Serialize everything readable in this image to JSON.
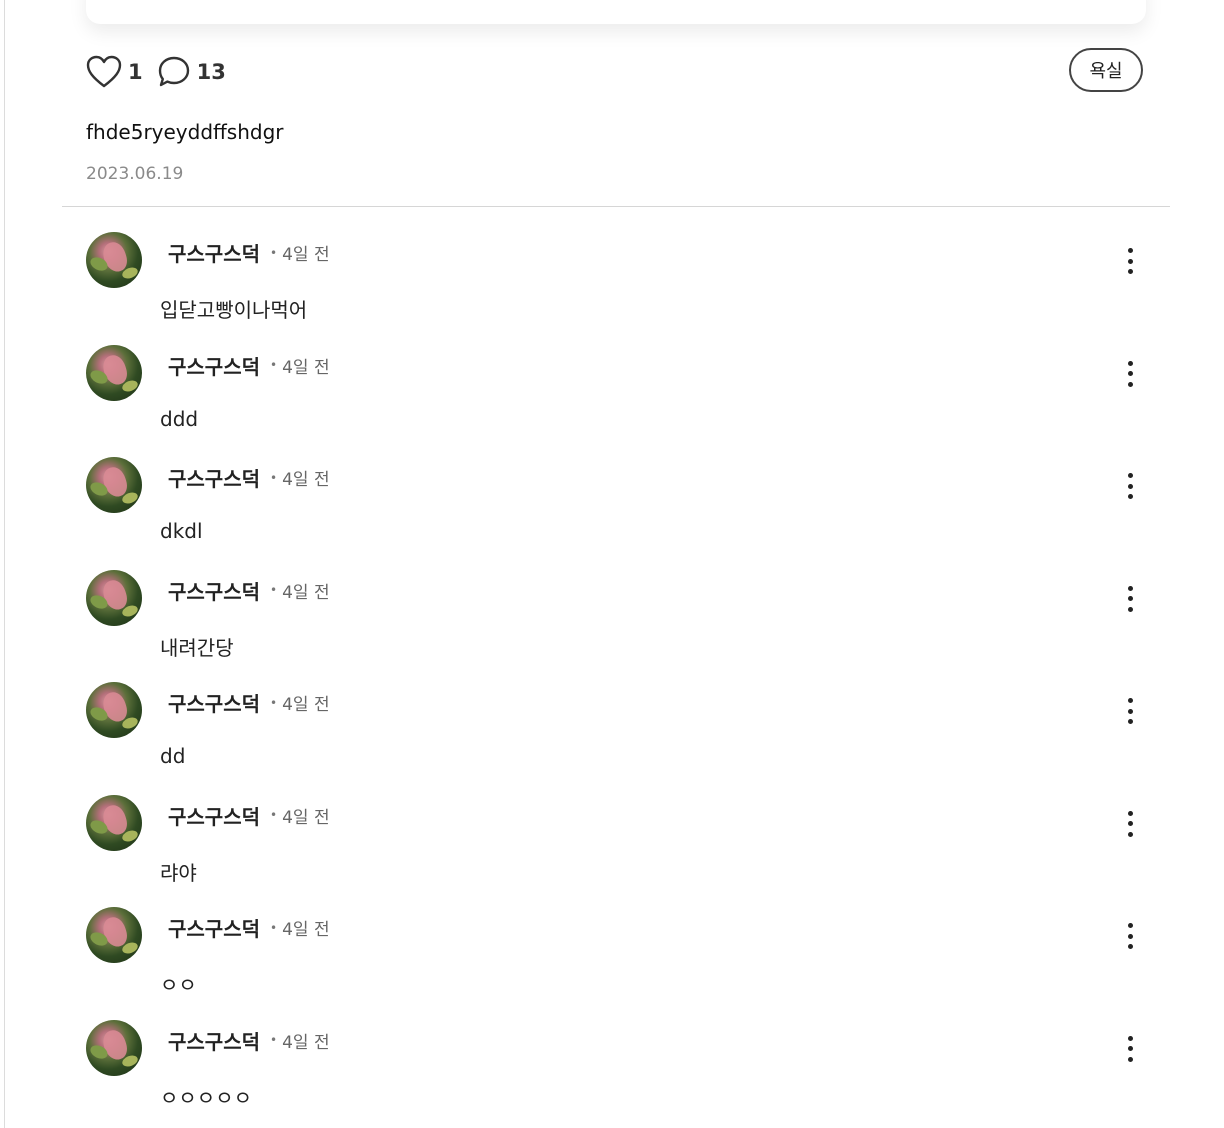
{
  "post": {
    "like_count": "1",
    "comment_count": "13",
    "report_label": "욕실",
    "body": "fhde5ryeyddffshdgr",
    "date": "2023.06.19"
  },
  "comments": [
    {
      "author": "구스구스덕",
      "separator": "•",
      "time": "4일 전",
      "text": "입닫고빵이나먹어"
    },
    {
      "author": "구스구스덕",
      "separator": "•",
      "time": "4일 전",
      "text": "ddd"
    },
    {
      "author": "구스구스덕",
      "separator": "•",
      "time": "4일 전",
      "text": "dkdl"
    },
    {
      "author": "구스구스덕",
      "separator": "•",
      "time": "4일 전",
      "text": "내려간당"
    },
    {
      "author": "구스구스덕",
      "separator": "•",
      "time": "4일 전",
      "text": "dd"
    },
    {
      "author": "구스구스덕",
      "separator": "•",
      "time": "4일 전",
      "text": "랴야"
    },
    {
      "author": "구스구스덕",
      "separator": "•",
      "time": "4일 전",
      "text": "ㅇㅇ"
    },
    {
      "author": "구스구스덕",
      "separator": "•",
      "time": "4일 전",
      "text": "ㅇㅇㅇㅇㅇ"
    }
  ],
  "icons": {
    "like": "heart-outline-icon",
    "comment": "speech-bubble-icon",
    "more": "vertical-ellipsis-icon"
  }
}
